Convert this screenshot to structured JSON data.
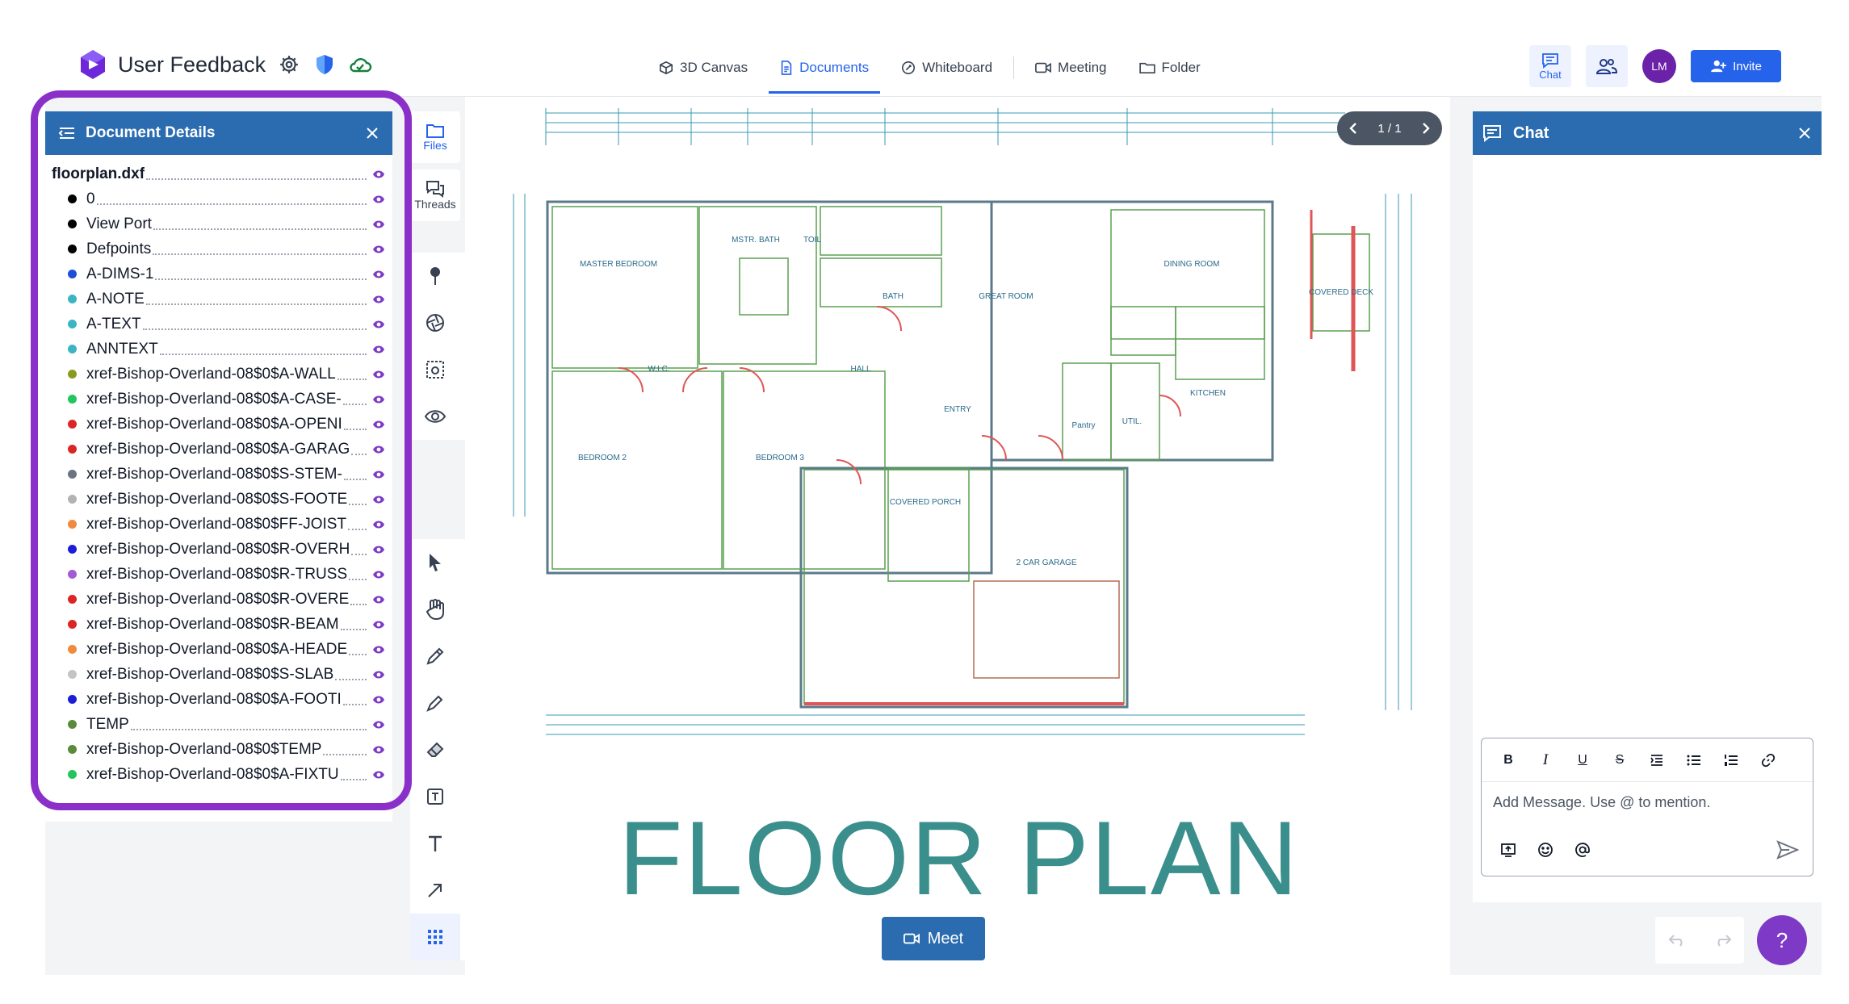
{
  "header": {
    "title": "User Feedback",
    "tabs": [
      {
        "label": "3D Canvas",
        "icon": "cube-icon"
      },
      {
        "label": "Documents",
        "icon": "document-icon",
        "active": true
      },
      {
        "label": "Whiteboard",
        "icon": "whiteboard-icon"
      },
      {
        "label": "Meeting",
        "icon": "video-icon"
      },
      {
        "label": "Folder",
        "icon": "folder-icon"
      }
    ],
    "chat_label": "Chat",
    "avatar_initials": "LM",
    "invite_label": "Invite"
  },
  "doc_panel": {
    "title": "Document Details",
    "layers": [
      {
        "name": "floorplan.dxf",
        "color": "",
        "root": true
      },
      {
        "name": "0",
        "color": "#000000"
      },
      {
        "name": "View Port",
        "color": "#000000"
      },
      {
        "name": "Defpoints",
        "color": "#000000"
      },
      {
        "name": "A-DIMS-1",
        "color": "#1d4ed8"
      },
      {
        "name": "A-NOTE",
        "color": "#3bb5c4"
      },
      {
        "name": "A-TEXT",
        "color": "#3bb5c4"
      },
      {
        "name": "ANNTEXT",
        "color": "#3bb5c4"
      },
      {
        "name": "xref-Bishop-Overland-08$0$A-WALL",
        "color": "#8a9a1e"
      },
      {
        "name": "xref-Bishop-Overland-08$0$A-CASE-",
        "color": "#22c55e"
      },
      {
        "name": "xref-Bishop-Overland-08$0$A-OPENI",
        "color": "#dc2626"
      },
      {
        "name": "xref-Bishop-Overland-08$0$A-GARAG",
        "color": "#dc2626"
      },
      {
        "name": "xref-Bishop-Overland-08$0$S-STEM-",
        "color": "#6b7280"
      },
      {
        "name": "xref-Bishop-Overland-08$0$S-FOOTE",
        "color": "#b3b3b3"
      },
      {
        "name": "xref-Bishop-Overland-08$0$FF-JOIST",
        "color": "#f08a3c"
      },
      {
        "name": "xref-Bishop-Overland-08$0$R-OVERH",
        "color": "#1d1dd8"
      },
      {
        "name": "xref-Bishop-Overland-08$0$R-TRUSS",
        "color": "#a05cd6"
      },
      {
        "name": "xref-Bishop-Overland-08$0$R-OVERE",
        "color": "#dc2626"
      },
      {
        "name": "xref-Bishop-Overland-08$0$R-BEAM",
        "color": "#dc2626"
      },
      {
        "name": "xref-Bishop-Overland-08$0$A-HEADE",
        "color": "#f08a3c"
      },
      {
        "name": "xref-Bishop-Overland-08$0$S-SLAB",
        "color": "#c4c4c4"
      },
      {
        "name": "xref-Bishop-Overland-08$0$A-FOOTI",
        "color": "#1d1dd8"
      },
      {
        "name": "TEMP",
        "color": "#5a8a3a"
      },
      {
        "name": "xref-Bishop-Overland-08$0$TEMP",
        "color": "#5a8a3a"
      },
      {
        "name": "xref-Bishop-Overland-08$0$A-FIXTU",
        "color": "#22c55e"
      }
    ]
  },
  "side_buttons": {
    "files": "Files",
    "threads": "Threads"
  },
  "canvas": {
    "page_indicator": "1 / 1",
    "drawing_title": "FLOOR PLAN",
    "meet_label": "Meet",
    "plan_labels": {
      "master_bedroom": "MASTER BEDROOM",
      "mstr_bath": "MSTR. BATH",
      "toil": "TOIL",
      "bath": "BATH",
      "great_room": "GREAT ROOM",
      "dining_room": "DINING ROOM",
      "covered_deck": "COVERED DECK",
      "wic": "W.I.C.",
      "hall": "HALL",
      "kitchen": "KITCHEN",
      "entry": "ENTRY",
      "pantry": "Pantry",
      "util": "UTIL.",
      "bedroom2": "BEDROOM 2",
      "bedroom3": "BEDROOM 3",
      "covered_porch": "COVERED PORCH",
      "garage": "2 CAR GARAGE"
    }
  },
  "chat": {
    "title": "Chat",
    "placeholder": "Add Message. Use @ to mention.",
    "format_buttons": [
      "B",
      "I",
      "U",
      "S"
    ]
  },
  "help_label": "?"
}
